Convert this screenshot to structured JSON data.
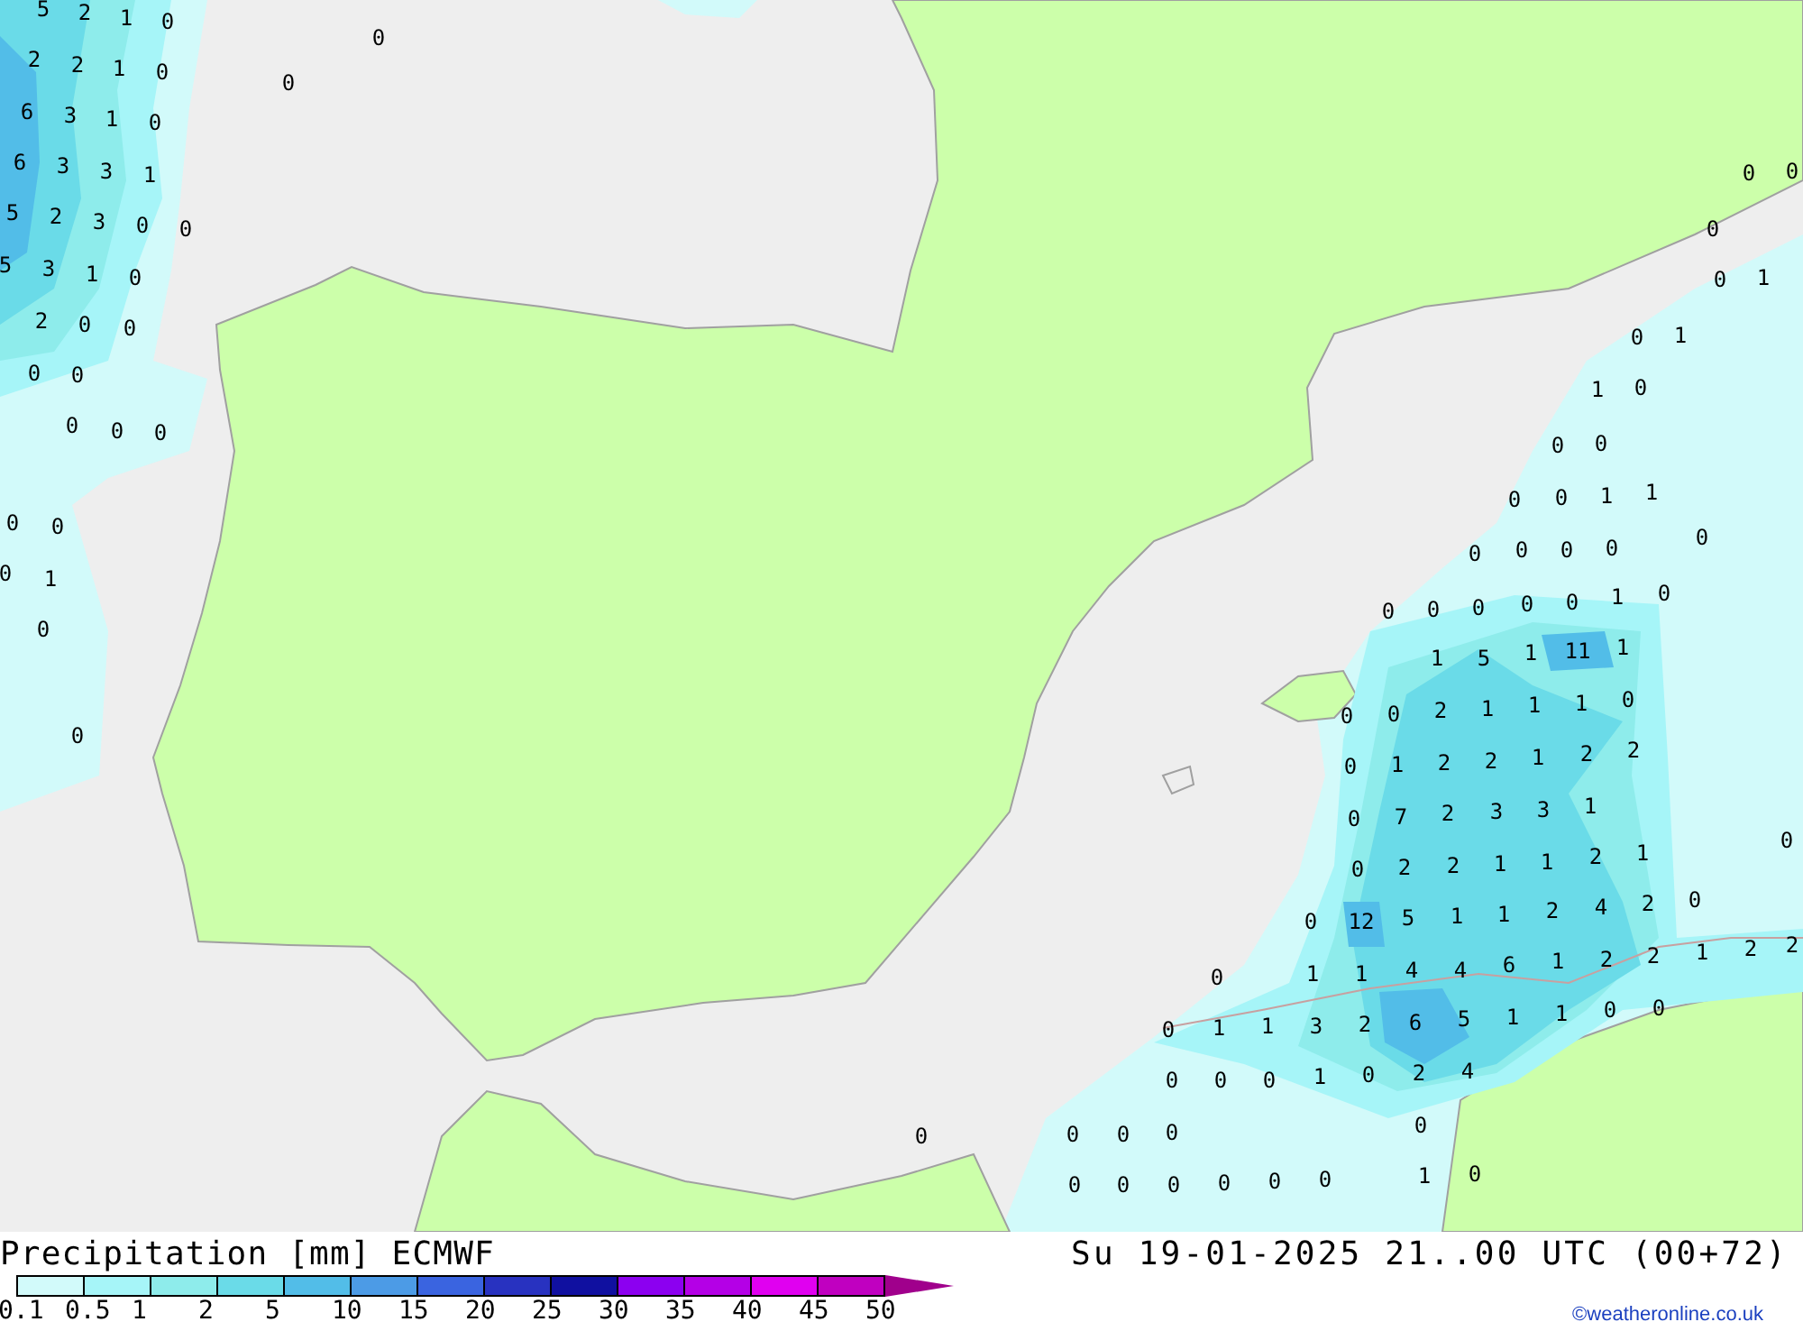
{
  "map": {
    "value_labels": [
      "5",
      "2",
      "1",
      "0",
      "0",
      "0",
      "2",
      "2",
      "1",
      "0",
      "6",
      "3",
      "1",
      "0",
      "6",
      "3",
      "3",
      "1",
      "5",
      "2",
      "3",
      "0",
      "0",
      "5",
      "3",
      "1",
      "0",
      "2",
      "0",
      "0",
      "0",
      "0",
      "0",
      "0",
      "0",
      "0",
      "0",
      "0",
      "1",
      "0",
      "0",
      "0",
      "0",
      "0",
      "0",
      "1",
      "0",
      "1",
      "1",
      "0",
      "0",
      "0",
      "0",
      "0",
      "1",
      "1",
      "0",
      "0",
      "0",
      "0",
      "0",
      "0",
      "0",
      "0",
      "0",
      "0",
      "1",
      "0",
      "1",
      "5",
      "1",
      "11",
      "1",
      "0",
      "0",
      "2",
      "1",
      "1",
      "1",
      "0",
      "0",
      "1",
      "2",
      "2",
      "1",
      "2",
      "2",
      "0",
      "7",
      "2",
      "3",
      "3",
      "1",
      "0",
      "0",
      "2",
      "2",
      "1",
      "1",
      "2",
      "1",
      "0",
      "12",
      "5",
      "1",
      "1",
      "2",
      "4",
      "2",
      "0",
      "0",
      "1",
      "1",
      "4",
      "4",
      "6",
      "1",
      "2",
      "2",
      "1",
      "2",
      "2",
      "0",
      "1",
      "1",
      "3",
      "2",
      "6",
      "5",
      "1",
      "1",
      "0",
      "0",
      "0",
      "0",
      "0",
      "1",
      "0",
      "2",
      "4",
      "0",
      "0",
      "0",
      "0",
      "0",
      "0",
      "0",
      "0",
      "0",
      "0",
      "0",
      "1",
      "0"
    ]
  },
  "footer": {
    "title": "Precipitation [mm] ECMWF",
    "valid_time": "Su 19-01-2025 21..00 UTC (00+72)",
    "credit": "©weatheronline.co.uk"
  },
  "legend": {
    "bins": [
      {
        "kind": "box",
        "color": "#d2fafa"
      },
      {
        "kind": "box",
        "color": "#a6f5f8"
      },
      {
        "kind": "box",
        "color": "#8eeceb"
      },
      {
        "kind": "box",
        "color": "#6adbe8"
      },
      {
        "kind": "box",
        "color": "#52bde8"
      },
      {
        "kind": "box",
        "color": "#4c9be6"
      },
      {
        "kind": "box",
        "color": "#3a64e0"
      },
      {
        "kind": "box",
        "color": "#2832c0"
      },
      {
        "kind": "box",
        "color": "#1010a0"
      },
      {
        "kind": "box",
        "color": "#8c00f0"
      },
      {
        "kind": "box",
        "color": "#b400e6"
      },
      {
        "kind": "box",
        "color": "#e000f0"
      },
      {
        "kind": "box",
        "color": "#c000c0"
      },
      {
        "kind": "arrow",
        "color": "#a0008c"
      }
    ],
    "ticks": [
      "0.1",
      "0.5",
      "1",
      "2",
      "5",
      "10",
      "15",
      "20",
      "25",
      "30",
      "35",
      "40",
      "45",
      "50"
    ]
  }
}
